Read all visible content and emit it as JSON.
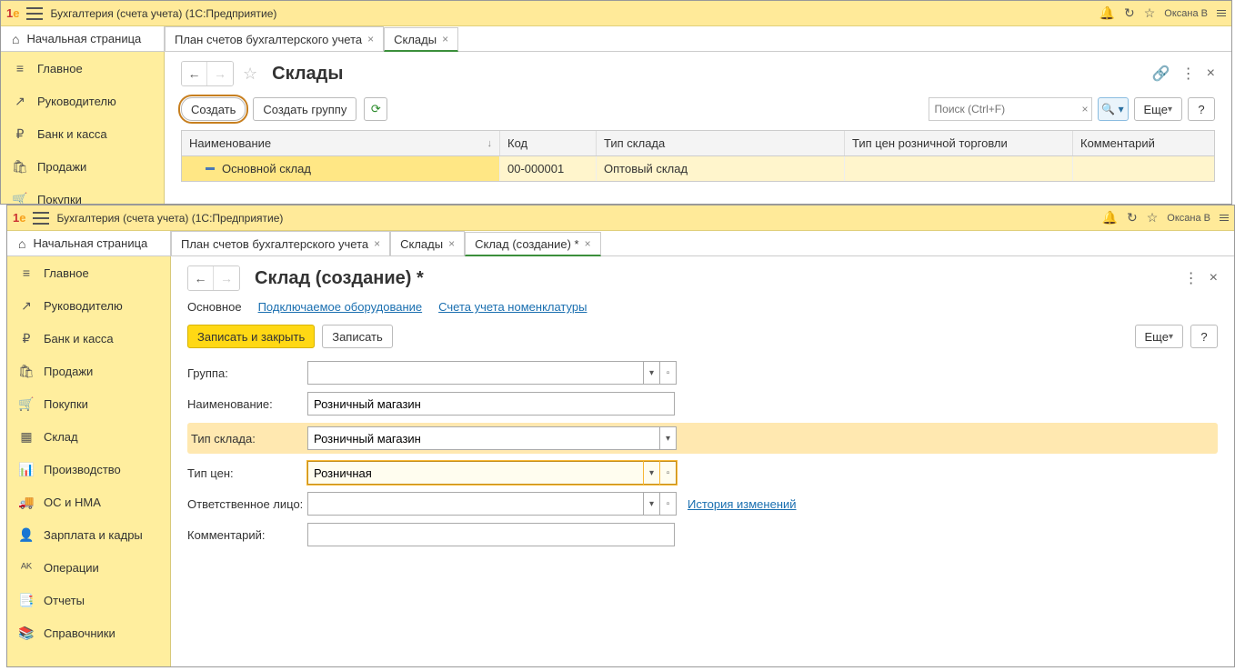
{
  "win1": {
    "titlebar": {
      "title": "Бухгалтерия (счета учета)  (1С:Предприятие)",
      "user": "Оксана В"
    },
    "home_tab": "Начальная страница",
    "tabs": [
      {
        "label": "План счетов бухгалтерского учета",
        "active": false
      },
      {
        "label": "Склады",
        "active": true
      }
    ],
    "sidebar": [
      {
        "icon": "≡",
        "label": "Главное"
      },
      {
        "icon": "↗",
        "label": "Руководителю"
      },
      {
        "icon": "₽",
        "label": "Банк и касса"
      },
      {
        "icon": "🛍",
        "label": "Продажи"
      },
      {
        "icon": "🛒",
        "label": "Покупки"
      }
    ],
    "page": {
      "title": "Склады",
      "create": "Создать",
      "create_group": "Создать группу",
      "search_ph": "Поиск (Ctrl+F)",
      "more": "Еще",
      "cols": {
        "name": "Наименование",
        "code": "Код",
        "type": "Тип склада",
        "price": "Тип цен розничной торговли",
        "comm": "Комментарий"
      },
      "row": {
        "name": "Основной склад",
        "code": "00-000001",
        "type": "Оптовый склад"
      }
    }
  },
  "win2": {
    "titlebar": {
      "title": "Бухгалтерия (счета учета)  (1С:Предприятие)",
      "user": "Оксана В"
    },
    "home_tab": "Начальная страница",
    "tabs": [
      {
        "label": "План счетов бухгалтерского учета",
        "active": false
      },
      {
        "label": "Склады",
        "active": false
      },
      {
        "label": "Склад (создание) *",
        "active": true
      }
    ],
    "sidebar": [
      {
        "icon": "≡",
        "label": "Главное"
      },
      {
        "icon": "↗",
        "label": "Руководителю"
      },
      {
        "icon": "₽",
        "label": "Банк и касса"
      },
      {
        "icon": "🛍",
        "label": "Продажи"
      },
      {
        "icon": "🛒",
        "label": "Покупки"
      },
      {
        "icon": "▦",
        "label": "Склад"
      },
      {
        "icon": "📊",
        "label": "Производство"
      },
      {
        "icon": "🚚",
        "label": "ОС и НМА"
      },
      {
        "icon": "👤",
        "label": "Зарплата и кадры"
      },
      {
        "icon": "ᴬᴷ",
        "label": "Операции"
      },
      {
        "icon": "📑",
        "label": "Отчеты"
      },
      {
        "icon": "📚",
        "label": "Справочники"
      }
    ],
    "page": {
      "title": "Склад (создание) *",
      "subtabs": {
        "main": "Основное",
        "equip": "Подключаемое оборудование",
        "accounts": "Счета учета номенклатуры"
      },
      "save_close": "Записать и закрыть",
      "save": "Записать",
      "more": "Еще",
      "fields": {
        "group": {
          "label": "Группа:",
          "value": ""
        },
        "name": {
          "label": "Наименование:",
          "value": "Розничный магазин"
        },
        "type": {
          "label": "Тип склада:",
          "value": "Розничный магазин"
        },
        "price": {
          "label": "Тип цен:",
          "value": "Розничная"
        },
        "resp": {
          "label": "Ответственное лицо:",
          "value": ""
        },
        "comm": {
          "label": "Комментарий:",
          "value": ""
        }
      },
      "history_link": "История изменений"
    }
  }
}
